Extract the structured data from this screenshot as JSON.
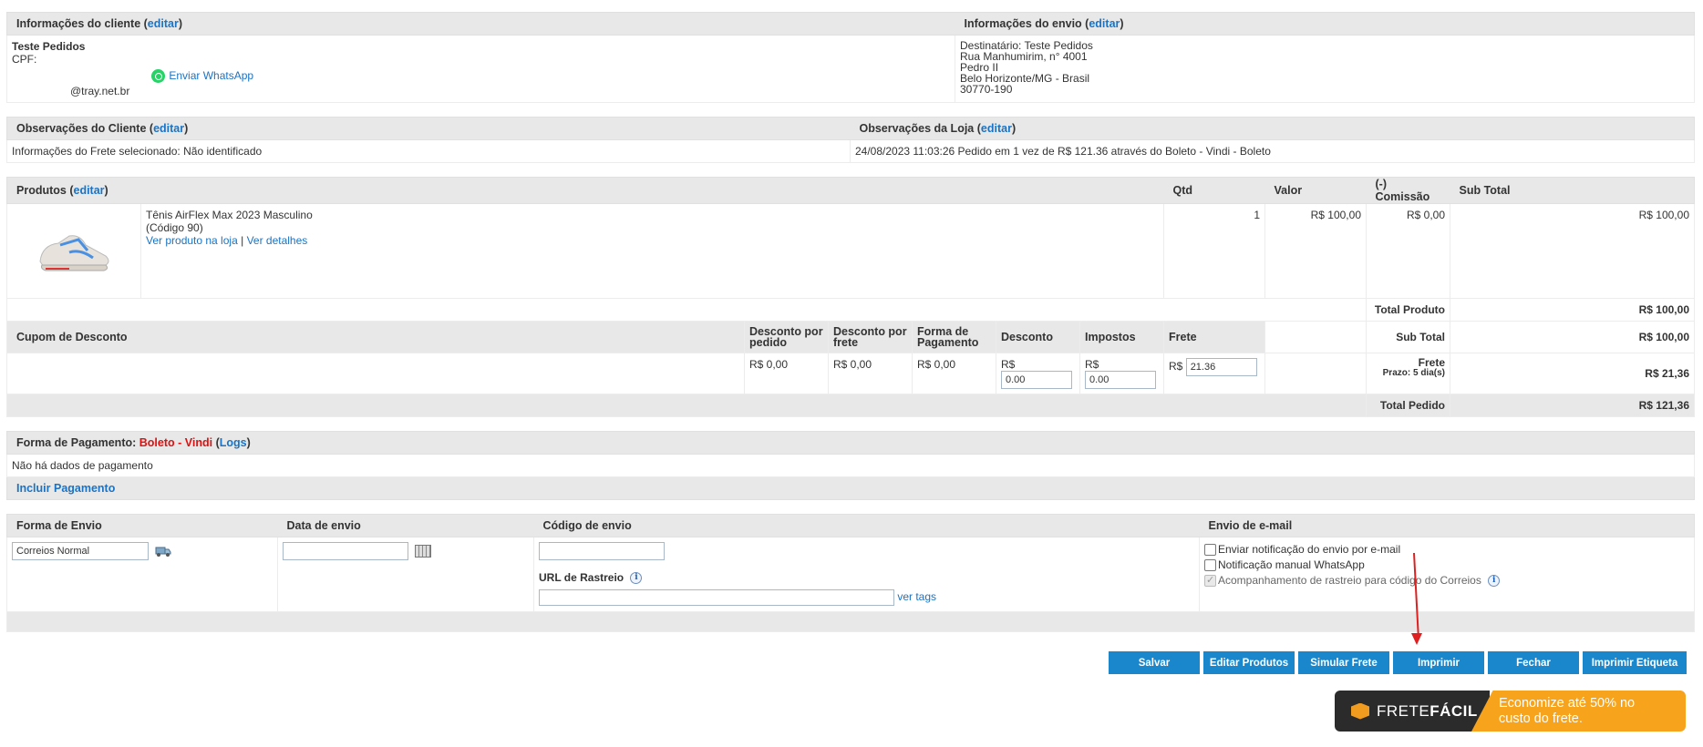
{
  "client": {
    "header_label": "Informações do cliente",
    "edit_label": "editar",
    "name": "Teste Pedidos",
    "cpf_label": "CPF:",
    "whatsapp_label": "Enviar WhatsApp",
    "email_suffix": "@tray.net.br"
  },
  "shipping_info": {
    "header_label": "Informações do envio",
    "edit_label": "editar",
    "lines": [
      "Destinatário: Teste Pedidos",
      "Rua Manhumirim, n° 4001",
      "Pedro II",
      "Belo Horizonte/MG - Brasil",
      "30770-190"
    ]
  },
  "observations": {
    "client_header": "Observações do Cliente",
    "store_header": "Observações da Loja",
    "edit_label": "editar",
    "client_text": "Informações do Frete selecionado: Não identificado",
    "store_text": "24/08/2023 11:03:26 Pedido em 1 vez de R$ 121.36 através do Boleto - Vindi - Boleto"
  },
  "products": {
    "header_label": "Produtos",
    "edit_label": "editar",
    "columns": [
      "Qtd",
      "Valor",
      "(-) Comissão",
      "Sub Total"
    ],
    "items": [
      {
        "name": "Tênis AirFlex Max 2023 Masculino",
        "code": "(Código 90)",
        "view_store_label": "Ver produto na loja",
        "separator": "|",
        "details_label": "Ver detalhes",
        "qty": "1",
        "value": "R$ 100,00",
        "commission": "R$ 0,00",
        "subtotal": "R$ 100,00"
      }
    ],
    "total_label": "Total Produto",
    "total_value": "R$ 100,00"
  },
  "discount": {
    "coupon_label": "Cupom de Desconto",
    "columns": [
      "Desconto por pedido",
      "Desconto por frete",
      "Forma de Pagamento",
      "Desconto",
      "Impostos",
      "Frete"
    ],
    "order_discount": "R$ 0,00",
    "shipping_discount": "R$ 0,00",
    "payment_discount": "R$ 0,00",
    "currency": "R$",
    "discount_value": "0.00",
    "tax_value": "0.00",
    "freight_value": "21.36",
    "subtotal_label": "Sub Total",
    "subtotal_value": "R$ 100,00",
    "freight_label": "Frete",
    "freight_term": "Prazo: 5 dia(s)",
    "freight_total": "R$ 21,36",
    "order_total_label": "Total Pedido",
    "order_total_value": "R$ 121,36"
  },
  "payment": {
    "label": "Forma de Pagamento:",
    "method": "Boleto - Vindi",
    "logs_label": "Logs",
    "no_data": "Não há dados de pagamento",
    "include_label": "Incluir Pagamento"
  },
  "shipping": {
    "columns": [
      "Forma de Envio",
      "Data de envio",
      "Código de envio",
      "Envio de e-mail"
    ],
    "method_value": "Correios Normal",
    "date_value": "",
    "code_value": "",
    "tracking_url_label": "URL de Rastreio",
    "tracking_url_value": "",
    "tags_label": "ver tags",
    "notify_email_label": "Enviar notificação do envio por e-mail",
    "notify_whatsapp_label": "Notificação manual WhatsApp",
    "tracking_follow_label": "Acompanhamento de rastreio para código do Correios"
  },
  "buttons": [
    "Salvar",
    "Editar Produtos",
    "Simular Frete",
    "Imprimir",
    "Fechar",
    "Imprimir Etiqueta"
  ],
  "banner": {
    "brand_light": "FRETE",
    "brand_bold": "FÁCIL",
    "text_line1": "Economize até 50% no",
    "text_line2": "custo do frete."
  },
  "colors": {
    "button_blue": "#1a87cc",
    "link_blue": "#1a73c4",
    "header_gray": "#e8e8e8",
    "payment_red": "#dd1111",
    "annotation_arrow": "#e02020"
  }
}
